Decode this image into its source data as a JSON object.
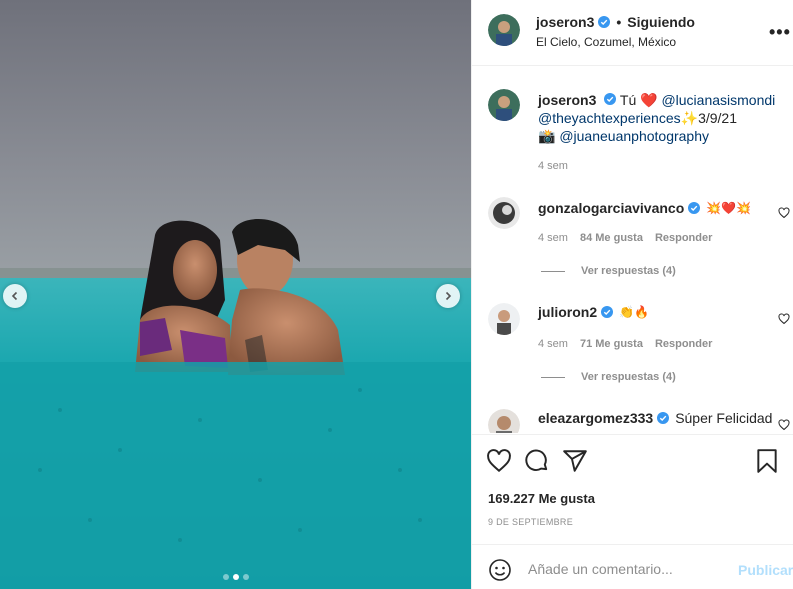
{
  "colors": {
    "sky": "#5f626c",
    "water": "#1aa3ad",
    "verified": "#3897f0",
    "link": "#00376b",
    "muted": "#8e8e8e",
    "publish": "#b2dffc"
  },
  "carousel": {
    "prev_icon": "chevron-left-icon",
    "next_icon": "chevron-right-icon",
    "dots": 3,
    "active_dot": 2
  },
  "header": {
    "username": "joseron3",
    "separator": "•",
    "follow_status": "Siguiendo",
    "location": "El Cielo, Cozumel, México",
    "more_label": "•••"
  },
  "caption": {
    "username": "joseron3",
    "text_1": "Tú",
    "emoji_1": "❤️",
    "mention_1": "@lucianasismondi",
    "mention_2": "@theyachtexperiences",
    "emoji_2": "✨",
    "date_text": "3/9/21",
    "emoji_3": "📸",
    "mention_3": "@juaneuanphotography",
    "time": "4 sem"
  },
  "comments": [
    {
      "username": "gonzalogarciavivanco",
      "text": "💥❤️💥",
      "time": "4 sem",
      "likes": "84 Me gusta",
      "reply": "Responder",
      "view_replies": "Ver respuestas (4)"
    },
    {
      "username": "julioron2",
      "text": "👏🔥",
      "time": "4 sem",
      "likes": "71 Me gusta",
      "reply": "Responder",
      "view_replies": "Ver respuestas (4)"
    },
    {
      "username": "eleazargomez333",
      "text": "Súper Felicidad"
    }
  ],
  "actions": {
    "like_icon": "heart-icon",
    "comment_icon": "comment-icon",
    "share_icon": "share-icon",
    "save_icon": "bookmark-icon",
    "likes_text": "169.227 Me gusta",
    "date": "9 DE SEPTIEMBRE"
  },
  "add_comment": {
    "emoji_icon": "smile-icon",
    "placeholder": "Añade un comentario...",
    "publish_label": "Publicar"
  }
}
